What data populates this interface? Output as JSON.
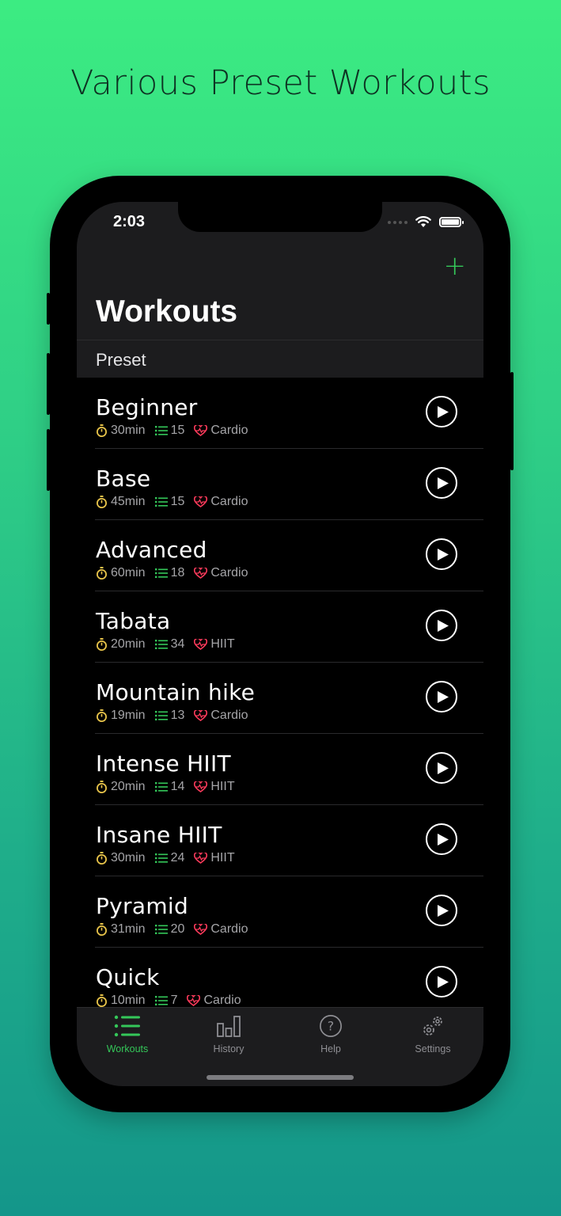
{
  "headline": "Various Preset Workouts",
  "status_bar": {
    "time": "2:03"
  },
  "nav": {
    "title": "Workouts",
    "add_label": "+"
  },
  "section": {
    "header": "Preset"
  },
  "colors": {
    "accent": "#34c759",
    "duration_icon": "#e8c44a",
    "count_icon": "#34c759",
    "heart_icon": "#ff3b5c"
  },
  "workouts": [
    {
      "name": "Beginner",
      "duration": "30min",
      "exercises": "15",
      "type": "Cardio"
    },
    {
      "name": "Base",
      "duration": "45min",
      "exercises": "15",
      "type": "Cardio"
    },
    {
      "name": "Advanced",
      "duration": "60min",
      "exercises": "18",
      "type": "Cardio"
    },
    {
      "name": "Tabata",
      "duration": "20min",
      "exercises": "34",
      "type": "HIIT"
    },
    {
      "name": "Mountain hike",
      "duration": "19min",
      "exercises": "13",
      "type": "Cardio"
    },
    {
      "name": "Intense HIIT",
      "duration": "20min",
      "exercises": "14",
      "type": "HIIT"
    },
    {
      "name": "Insane HIIT",
      "duration": "30min",
      "exercises": "24",
      "type": "HIIT"
    },
    {
      "name": "Pyramid",
      "duration": "31min",
      "exercises": "20",
      "type": "Cardio"
    },
    {
      "name": "Quick",
      "duration": "10min",
      "exercises": "7",
      "type": "Cardio"
    }
  ],
  "tabs": [
    {
      "label": "Workouts",
      "icon": "list-icon",
      "active": true
    },
    {
      "label": "History",
      "icon": "bar-chart-icon",
      "active": false
    },
    {
      "label": "Help",
      "icon": "question-icon",
      "active": false
    },
    {
      "label": "Settings",
      "icon": "gear-icon",
      "active": false
    }
  ]
}
